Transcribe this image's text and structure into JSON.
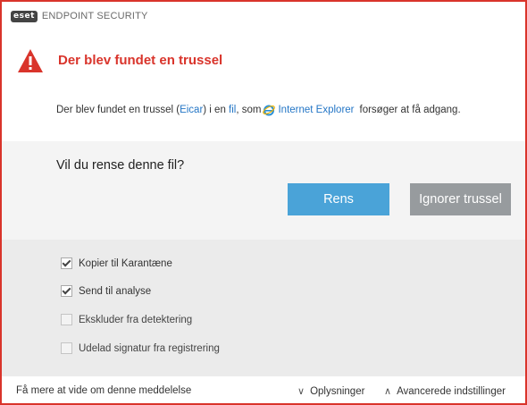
{
  "app": {
    "logo_text": "eset",
    "title": "ENDPOINT SECURITY"
  },
  "alert": {
    "title": "Der blev fundet en trussel",
    "detail_prefix": "Der blev fundet en trussel (",
    "threat_name": "Eicar",
    "detail_mid": ") i en ",
    "file_link": "fil",
    "detail_comma": ", som",
    "app_link": "Internet Explorer",
    "detail_suffix": "forsøger at få adgang.",
    "icon": "warning-icon",
    "accent_color": "#d9342b"
  },
  "question": {
    "text": "Vil du rense denne fil?",
    "clean_label": "Rens",
    "ignore_label": "Ignorer trussel"
  },
  "options": [
    {
      "label": "Kopier til Karantæne",
      "checked": true
    },
    {
      "label": "Send til analyse",
      "checked": true
    },
    {
      "label": "Ekskluder fra detektering",
      "checked": false
    },
    {
      "label": "Udelad signatur fra registrering",
      "checked": false
    }
  ],
  "footer": {
    "learn_more": "Få mere at vide om denne meddelelse",
    "details": "Oplysninger",
    "advanced": "Avancerede indstillinger"
  }
}
